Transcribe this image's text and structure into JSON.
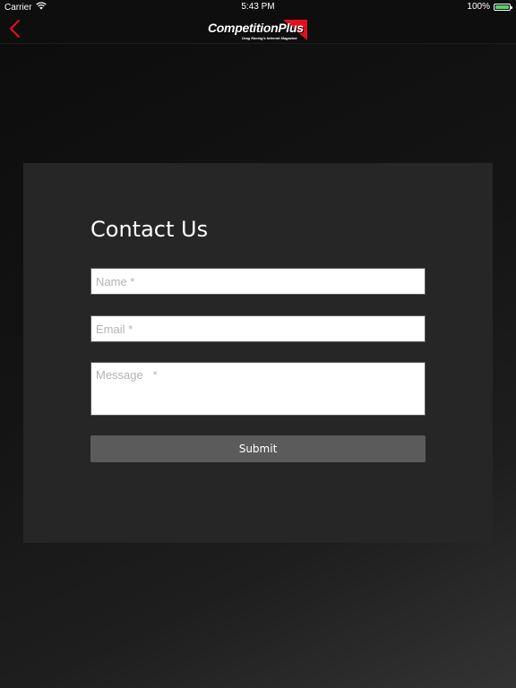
{
  "status_bar": {
    "carrier": "Carrier",
    "time": "5:43 PM",
    "battery_label": "100%",
    "battery_level": 1.0,
    "wifi_icon": "wifi-icon",
    "battery_icon": "battery-icon"
  },
  "nav": {
    "back_icon": "chevron-left-icon",
    "logo": {
      "title": "CompetitionPlus",
      "subtitle": "Drag Racing's Internet Magazine"
    }
  },
  "colors": {
    "accent": "#e0101e",
    "background": "#111111",
    "panel": "#262626",
    "submit": "#5b5b5b",
    "battery": "#4cd964"
  },
  "form": {
    "title": "Contact Us",
    "name_placeholder": "Name *",
    "email_placeholder": "Email *",
    "message_placeholder": "Message   *",
    "name_value": "",
    "email_value": "",
    "message_value": "",
    "submit_label": "Submit"
  }
}
